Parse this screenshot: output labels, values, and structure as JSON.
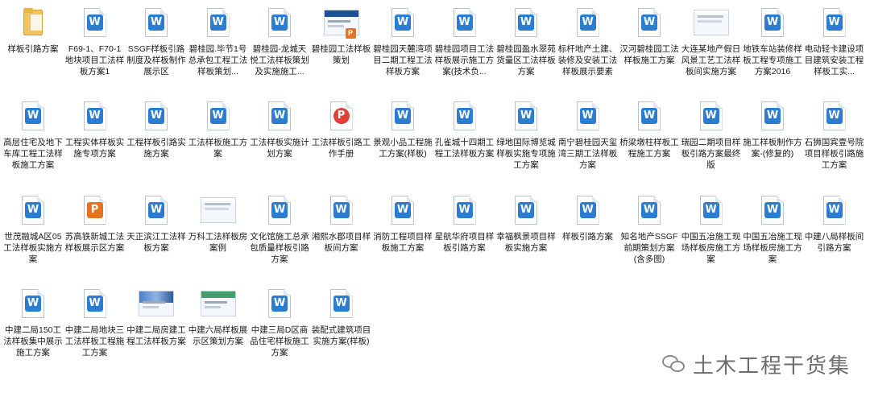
{
  "files": [
    {
      "label": "样板引路方案",
      "icon": "folder-icon"
    },
    {
      "label": "F69-1、F70-1地块项目工法样板方案1",
      "icon": "word-icon"
    },
    {
      "label": "SSGF样板引路制度及样板制作展示区",
      "icon": "word-icon"
    },
    {
      "label": "碧桂园.毕节1号总承包工程工法样板策划...",
      "icon": "word-icon"
    },
    {
      "label": "碧桂园-龙城天悦工法样板策划及实施施工...",
      "icon": "word-icon"
    },
    {
      "label": "碧桂园工法样板策划",
      "icon": "ppt-thumbnail-icon"
    },
    {
      "label": "碧桂园天麓湾项目二期工程工法样板方案",
      "icon": "word-icon"
    },
    {
      "label": "碧桂园项目工法样板展示施工方案(技术负...",
      "icon": "word-icon"
    },
    {
      "label": "碧桂园盈水翠苑货量区工法样板方案",
      "icon": "word-icon"
    },
    {
      "label": "标杆地产土建、装修及安装工法样板展示要素",
      "icon": "word-icon"
    },
    {
      "label": "汉河碧桂园工法样板施工方案",
      "icon": "word-icon"
    },
    {
      "label": "大连某地产假日风景工艺工法样板间实施方案",
      "icon": "text-thumbnail-icon"
    },
    {
      "label": "地铁车站装修样板工程专项施工方案2016",
      "icon": "word-icon"
    },
    {
      "label": "电动轻卡建设项目建筑安装工程样板工实...",
      "icon": "word-icon"
    },
    {
      "label": "高层住宅及地下车库工程工法样板施工方案",
      "icon": "word-icon"
    },
    {
      "label": "工程实体样板实施专项方案",
      "icon": "word-icon"
    },
    {
      "label": "工程样板引路实施方案",
      "icon": "word-icon"
    },
    {
      "label": "工法样板施工方案",
      "icon": "word-icon"
    },
    {
      "label": "工法样板实施计划方案",
      "icon": "word-icon"
    },
    {
      "label": "工法样板引路工作手册",
      "icon": "pdf-icon"
    },
    {
      "label": "景观小品工程施工方案(样板)",
      "icon": "word-icon"
    },
    {
      "label": "孔雀城十四期工程工法样板方案",
      "icon": "word-icon"
    },
    {
      "label": "绿地国际博览城样板实施专项施工方案",
      "icon": "word-icon"
    },
    {
      "label": "南宁碧桂园天玺湾三期工法样板方案",
      "icon": "word-icon"
    },
    {
      "label": "桥梁墩柱样板工程施工方案",
      "icon": "word-icon"
    },
    {
      "label": "瑞园二期项目样板引路方案最终版",
      "icon": "word-icon"
    },
    {
      "label": "施工样板制作方案-(修复的)",
      "icon": "word-icon"
    },
    {
      "label": "石狮国宾壹号院项目样板引路施工方案",
      "icon": "word-icon"
    },
    {
      "label": "世茂融城A区05工法样板实施方案",
      "icon": "word-icon"
    },
    {
      "label": "苏高铁新城工法样板展示区方案",
      "icon": "ppt-icon"
    },
    {
      "label": "天正滨江工法样板方案",
      "icon": "word-icon"
    },
    {
      "label": "万科工法样板房案例",
      "icon": "text-thumbnail-icon"
    },
    {
      "label": "文化馆施工总承包质量样板引路方案",
      "icon": "word-icon"
    },
    {
      "label": "湘熙水郡项目样板间方案",
      "icon": "word-icon"
    },
    {
      "label": "消防工程项目样板施工方案",
      "icon": "word-icon"
    },
    {
      "label": "星航华府项目样板引路方案",
      "icon": "word-icon"
    },
    {
      "label": "幸福枫景项目样板实施方案",
      "icon": "word-icon"
    },
    {
      "label": "样板引路方案",
      "icon": "word-icon"
    },
    {
      "label": "知名地产SSGF前期策划方案(含多图)",
      "icon": "word-icon"
    },
    {
      "label": "中国五冶施工现场样板房施工方案",
      "icon": "word-icon"
    },
    {
      "label": "中国五冶施工现场样板房施工方案",
      "icon": "word-icon"
    },
    {
      "label": "中建八局样板间引路方案",
      "icon": "word-icon"
    },
    {
      "label": "中建二局150工法样板集中展示施工方案",
      "icon": "word-icon"
    },
    {
      "label": "中建二局地块三工法样板工程施工方案",
      "icon": "word-icon"
    },
    {
      "label": "中建二局房建工程工法样板方案",
      "icon": "image-thumbnail-icon"
    },
    {
      "label": "中建六局样板展示区策划方案",
      "icon": "green-thumbnail-icon"
    },
    {
      "label": "中建三局D区商品住宅样板施工方案",
      "icon": "word-icon"
    },
    {
      "label": "装配式建筑项目实施方案(样板)",
      "icon": "word-icon"
    }
  ],
  "watermark": {
    "text": "土木工程干货集",
    "icon": "wechat-icon"
  }
}
